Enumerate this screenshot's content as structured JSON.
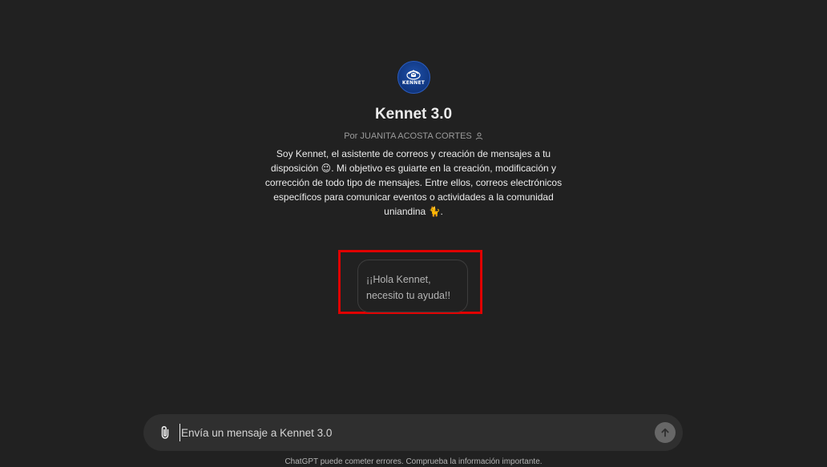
{
  "gpt": {
    "logo_text": "KENNET",
    "name": "Kennet 3.0",
    "byline": "Por JUANITA ACOSTA CORTES",
    "description": "Soy Kennet, el asistente de correos y creación de mensajes a tu disposición 😉. Mi objetivo es guiarte en la creación, modificación y corrección de todo tipo de mensajes. Entre ellos, correos electrónicos específicos para comunicar eventos o actividades a la comunidad uniandina 🐈."
  },
  "conversation_starters": [
    {
      "text": "¡¡Hola Kennet, necesito tu ayuda!!"
    }
  ],
  "composer": {
    "placeholder": "Envía un mensaje a Kennet 3.0",
    "attach_icon": "paperclip-icon",
    "send_icon": "arrow-up-icon"
  },
  "footer": {
    "note": "ChatGPT puede cometer errores. Comprueba la información importante."
  },
  "colors": {
    "background": "#212121",
    "composer_bg": "#2f2f2f",
    "highlight_border": "#e00000",
    "logo_bg": "#123a86"
  }
}
